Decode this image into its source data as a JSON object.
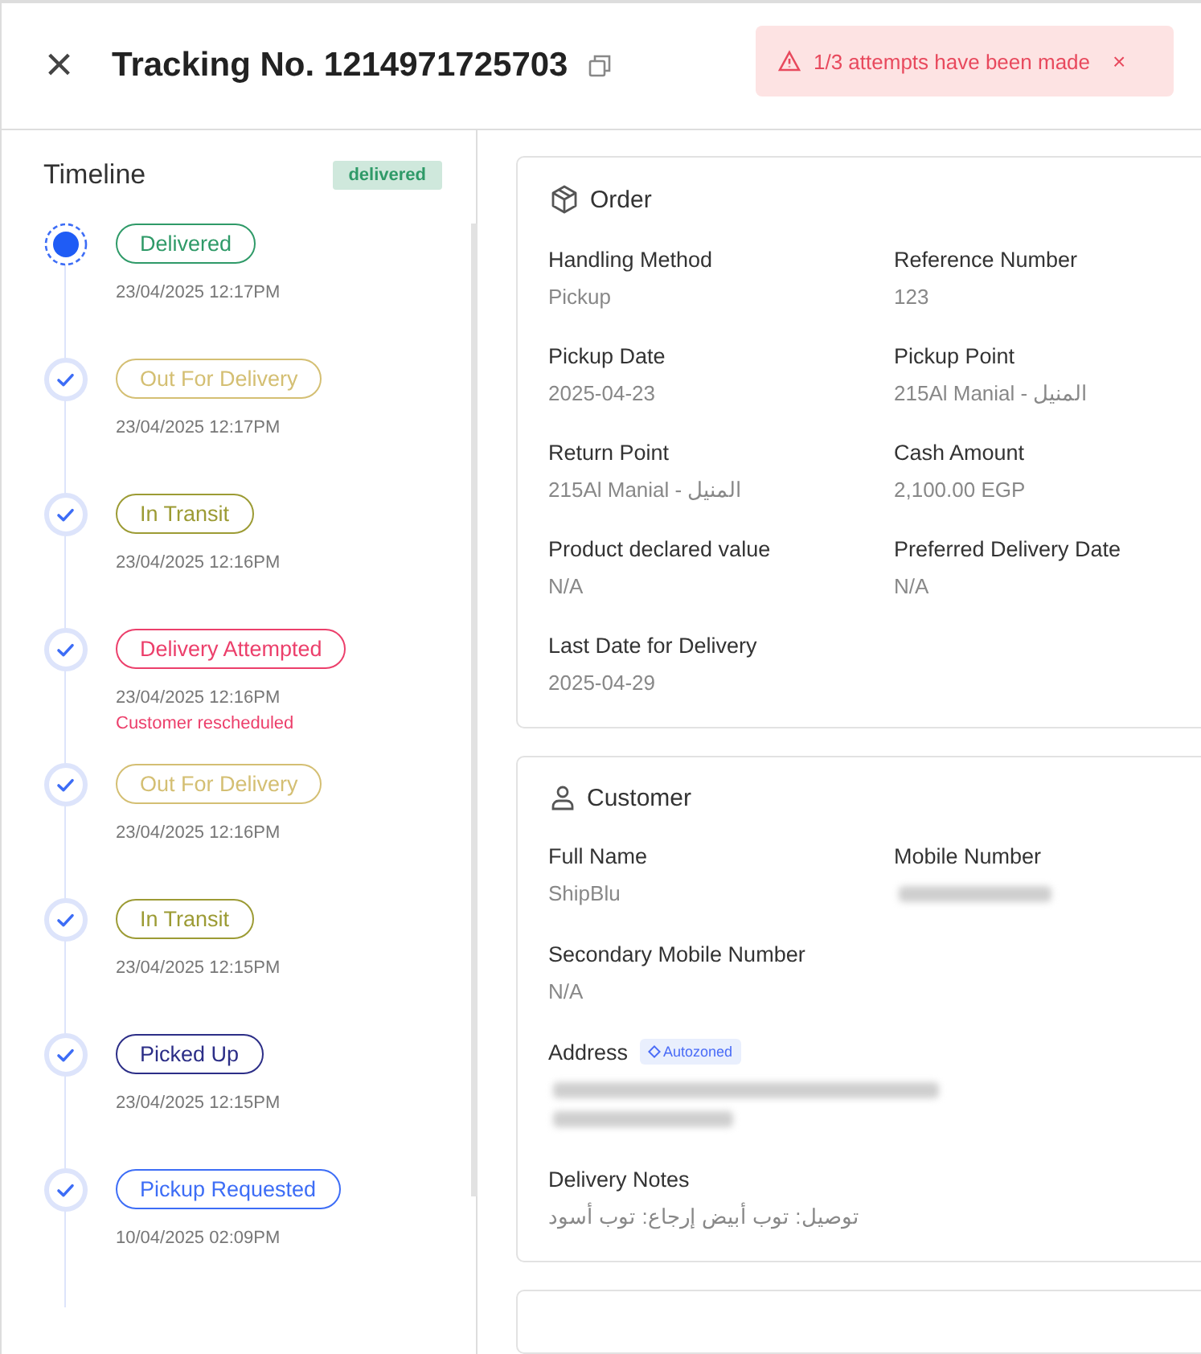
{
  "header": {
    "close_icon": "×",
    "title": "Tracking No. 1214971725703"
  },
  "alert": {
    "message": "1/3 attempts have been made",
    "dismiss": "×"
  },
  "timeline": {
    "title": "Timeline",
    "status_badge": "delivered",
    "events": [
      {
        "status": "Delivered",
        "color": "#2f9a68",
        "kind": "current",
        "time": "23/04/2025 12:17PM"
      },
      {
        "status": "Out For Delivery",
        "color": "#d4bf73",
        "kind": "done",
        "time": "23/04/2025 12:17PM"
      },
      {
        "status": "In Transit",
        "color": "#9c9b34",
        "kind": "done",
        "time": "23/04/2025 12:16PM"
      },
      {
        "status": "Delivery Attempted",
        "color": "#ec3f6b",
        "kind": "done",
        "time": "23/04/2025 12:16PM",
        "note": "Customer rescheduled"
      },
      {
        "status": "Out For Delivery",
        "color": "#d4bf73",
        "kind": "done",
        "time": "23/04/2025 12:16PM"
      },
      {
        "status": "In Transit",
        "color": "#9c9b34",
        "kind": "done",
        "time": "23/04/2025 12:15PM"
      },
      {
        "status": "Picked Up",
        "color": "#2c2e87",
        "kind": "done",
        "time": "23/04/2025 12:15PM"
      },
      {
        "status": "Pickup Requested",
        "color": "#3d6df6",
        "kind": "done",
        "time": "10/04/2025 02:09PM"
      }
    ]
  },
  "order": {
    "title": "Order",
    "fields": [
      {
        "label": "Handling Method",
        "value": "Pickup",
        "kind": "text"
      },
      {
        "label": "Reference Number",
        "value": "123",
        "kind": "text"
      },
      {
        "label": "Pickup Date",
        "value": "2025-04-23",
        "kind": "text"
      },
      {
        "label": "Pickup Point",
        "value": "215Al Manial - المنيل",
        "kind": "text"
      },
      {
        "label": "Return Point",
        "value": "215Al Manial - المنيل",
        "kind": "text"
      },
      {
        "label": "Cash Amount",
        "value": "2,100.00 EGP",
        "kind": "text"
      },
      {
        "label": "Product declared value",
        "value": "N/A",
        "kind": "text"
      },
      {
        "label": "Preferred Delivery Date",
        "value": "N/A",
        "kind": "text"
      },
      {
        "label": "Last Date for Delivery",
        "value": "2025-04-29",
        "kind": "text"
      }
    ]
  },
  "customer": {
    "title": "Customer",
    "fields": [
      {
        "label": "Full Name",
        "value": "ShipBlu",
        "kind": "text"
      },
      {
        "label": "Mobile Number",
        "kind": "redacted"
      },
      {
        "label": "Secondary Mobile Number",
        "value": "N/A",
        "kind": "text",
        "wide": true
      },
      {
        "label": "Address",
        "badge": "Autozoned",
        "kind": "redacted",
        "wide": true
      },
      {
        "label": "Delivery Notes",
        "value": "توصيل: توب أبيض إرجاع: توب أسود",
        "kind": "text",
        "wide": true
      }
    ]
  }
}
